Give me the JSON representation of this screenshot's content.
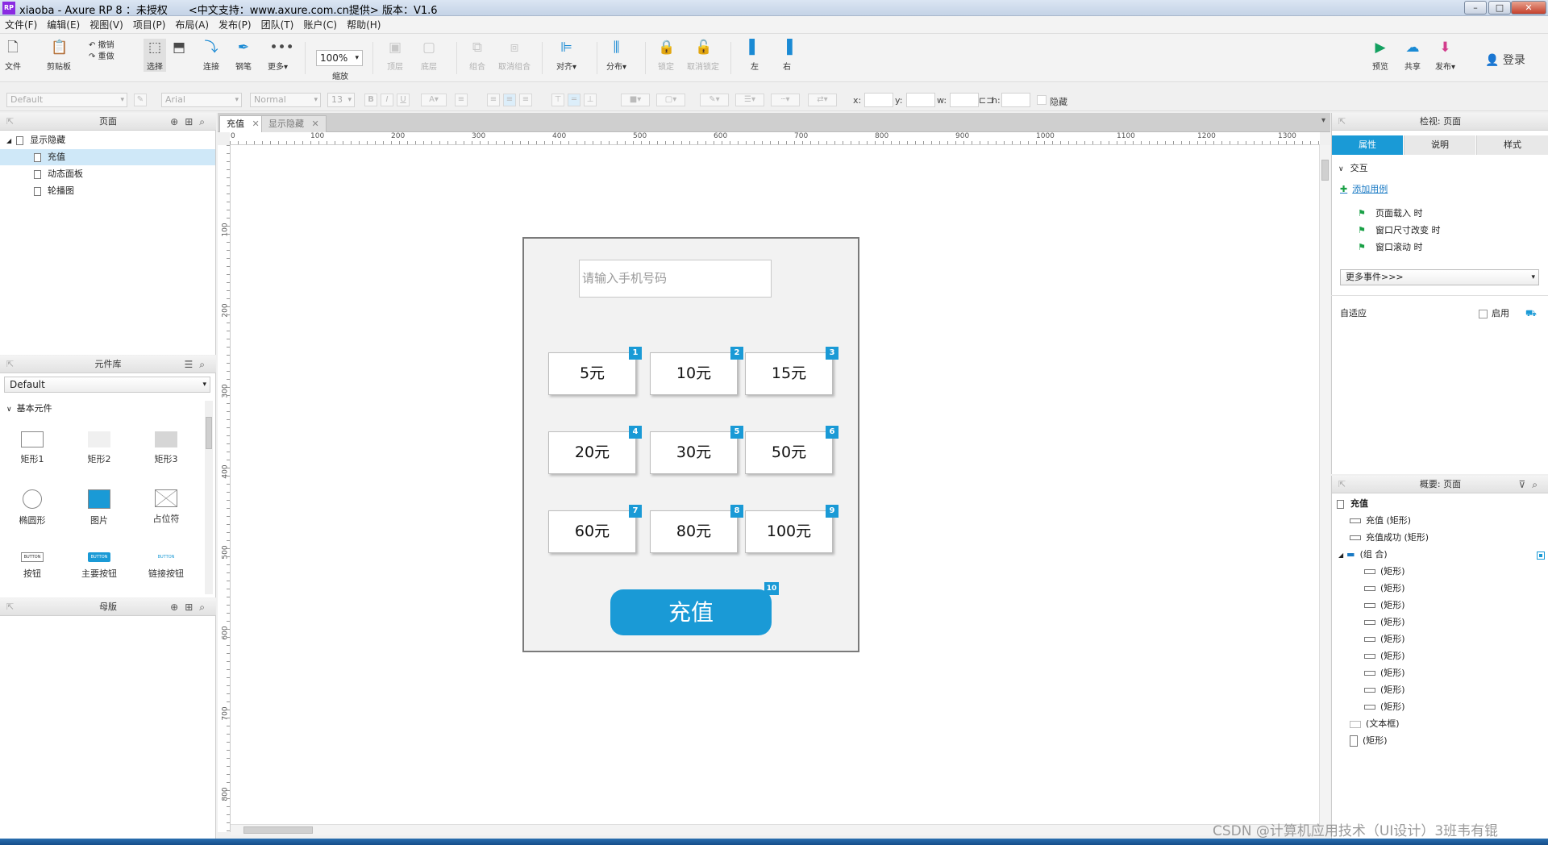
{
  "window": {
    "title": "xiaoba - Axure RP 8 ：未授权　　<中文支持：www.axure.com.cn提供> 版本：V1.6",
    "app_icon": "RP"
  },
  "menu": [
    "文件(F)",
    "编辑(E)",
    "视图(V)",
    "项目(P)",
    "布局(A)",
    "发布(P)",
    "团队(T)",
    "账户(C)",
    "帮助(H)"
  ],
  "toolbar": {
    "file": "文件",
    "clipboard": "剪贴板",
    "undo": "撤销",
    "redo": "重做",
    "select": "选择",
    "connect": "连接",
    "pen": "钢笔",
    "more": "更多▾",
    "zoom_value": "100%",
    "zoom": "缩放",
    "top": "顶层",
    "bottom": "底层",
    "group": "组合",
    "ungroup": "取消组合",
    "align": "对齐▾",
    "distribute": "分布▾",
    "lock": "锁定",
    "unlock": "取消锁定",
    "left": "左",
    "right": "右",
    "preview": "预览",
    "share": "共享",
    "publish": "发布▾",
    "login": "登录"
  },
  "format": {
    "style": "Default",
    "font": "Arial",
    "weight": "Normal",
    "size": "13",
    "x_label": "x:",
    "y_label": "y:",
    "w_label": "w:",
    "h_label": "h:",
    "hide_label": "隐藏"
  },
  "pages_panel": {
    "title": "页面",
    "root": "显示隐藏",
    "pages": [
      "充值",
      "动态面板",
      "轮播图"
    ]
  },
  "library_panel": {
    "title": "元件库",
    "selected": "Default",
    "section": "基本元件",
    "widgets": [
      "矩形1",
      "矩形2",
      "矩形3",
      "椭圆形",
      "图片",
      "占位符",
      "按钮",
      "主要按钮",
      "链接按钮"
    ],
    "button_text": "BUTTON"
  },
  "masters_panel": {
    "title": "母版"
  },
  "tabs": [
    "充值",
    "显示隐藏"
  ],
  "ruler": {
    "h": [
      "0",
      "100",
      "200",
      "300",
      "400",
      "500",
      "600",
      "700",
      "800",
      "900",
      "1000",
      "1100",
      "1200",
      "1300"
    ],
    "v": [
      "100",
      "200",
      "300",
      "400",
      "500",
      "600",
      "700",
      "800"
    ]
  },
  "prototype": {
    "phone_placeholder": "请输入手机号码",
    "amounts": [
      "5元",
      "10元",
      "15元",
      "20元",
      "30元",
      "50元",
      "60元",
      "80元",
      "100元"
    ],
    "badges": [
      "1",
      "2",
      "3",
      "4",
      "5",
      "6",
      "7",
      "8",
      "9"
    ],
    "charge_button": "充值",
    "charge_badge": "10"
  },
  "inspector": {
    "title": "检视: 页面",
    "tabs": [
      "属性",
      "说明",
      "样式"
    ],
    "interaction": "交互",
    "add_case": "添加用例",
    "events": [
      "页面载入 时",
      "窗口尺寸改变 时",
      "窗口滚动 时"
    ],
    "more_events": "更多事件>>>",
    "adaptive": "自适应",
    "enable": "启用"
  },
  "outline": {
    "title": "概要: 页面",
    "root": "充值",
    "items": [
      "充值 (矩形)",
      "充值成功 (矩形)"
    ],
    "group": "(组 合)",
    "group_children": [
      "(矩形)",
      "(矩形)",
      "(矩形)",
      "(矩形)",
      "(矩形)",
      "(矩形)",
      "(矩形)",
      "(矩形)",
      "(矩形)"
    ],
    "after": [
      "(文本框)",
      "(矩形)"
    ]
  },
  "watermark": "CSDN @计算机应用技术（UI设计）3班韦有锟",
  "colors": {
    "accent": "#1a9ad6"
  }
}
